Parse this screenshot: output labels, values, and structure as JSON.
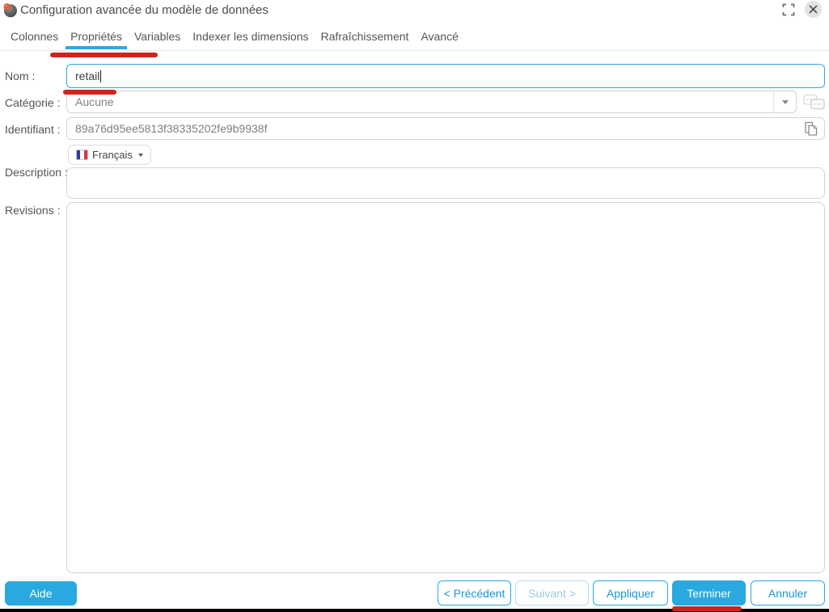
{
  "window": {
    "title": "Configuration avancée du modèle de données"
  },
  "tabs": [
    {
      "label": "Colonnes",
      "active": false
    },
    {
      "label": "Propriétés",
      "active": true
    },
    {
      "label": "Variables",
      "active": false
    },
    {
      "label": "Indexer les dimensions",
      "active": false
    },
    {
      "label": "Rafraîchissement",
      "active": false
    },
    {
      "label": "Avancé",
      "active": false
    }
  ],
  "form": {
    "nom": {
      "label": "Nom :",
      "value": "retail"
    },
    "categorie": {
      "label": "Catégorie :",
      "value": "Aucune"
    },
    "identifiant": {
      "label": "Identifiant :",
      "value": "89a76d95ee5813f38335202fe9b9938f"
    },
    "langue": {
      "value": "Français"
    },
    "description": {
      "label": "Description :",
      "value": ""
    },
    "revisions": {
      "label": "Revisions :",
      "value": ""
    }
  },
  "footer": {
    "aide": "Aide",
    "precedent": "< Précédent",
    "suivant": "Suivant >",
    "appliquer": "Appliquer",
    "terminer": "Terminer",
    "annuler": "Annuler"
  },
  "icons": {
    "app": "model-sphere-icon",
    "maximize": "maximize-icon",
    "close": "close-icon",
    "dropdown": "chevron-down-icon",
    "categories": "categories-icon",
    "copy": "copy-icon",
    "flag": "french-flag-icon"
  },
  "colors": {
    "accent_blue": "#29a9e0",
    "annotation_red": "#d0231c",
    "disabled_blue_border": "#b5e0f4",
    "disabled_blue_text": "#9dcbe4"
  }
}
